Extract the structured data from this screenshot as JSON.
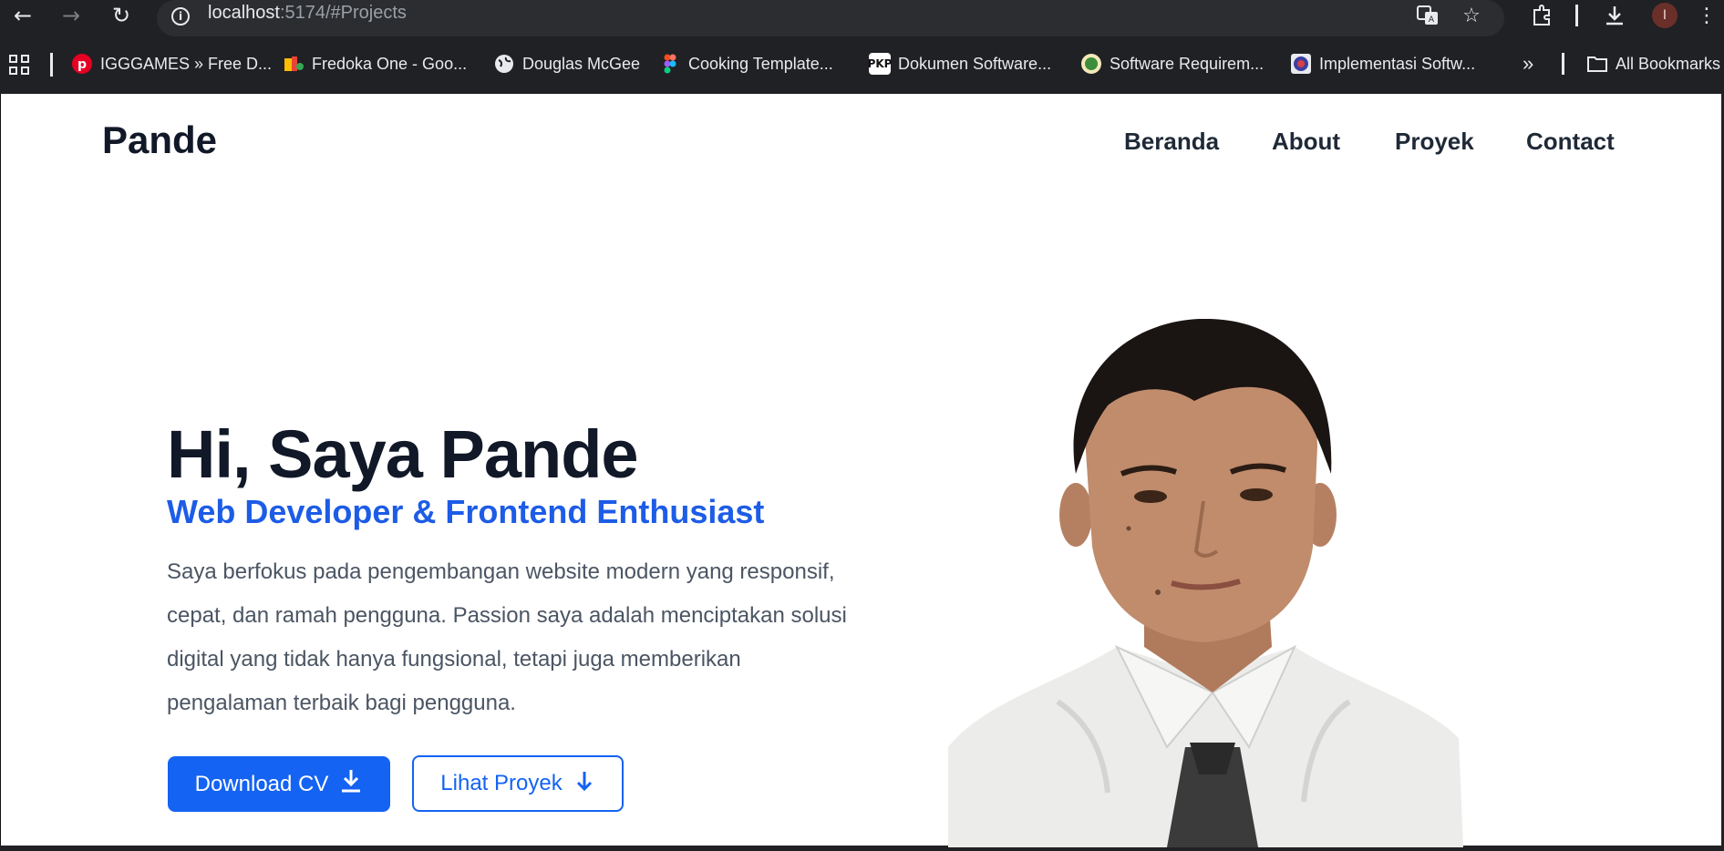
{
  "browser": {
    "url_host": "localhost",
    "url_rest": ":5174/#Projects",
    "profile_initial": "I",
    "bookmarks": [
      "IGGGAMES » Free D...",
      "Fredoka One - Goo...",
      "Douglas McGee",
      "Cooking Template...",
      "Dokumen Software...",
      "Software Requirem...",
      "Implementasi Softw..."
    ],
    "overflow_label": "»",
    "all_bookmarks": "All Bookmarks"
  },
  "site": {
    "logo": "Pande",
    "nav": [
      "Beranda",
      "About",
      "Proyek",
      "Contact"
    ]
  },
  "hero": {
    "title": "Hi, Saya Pande",
    "subtitle": "Web Developer & Frontend Enthusiast",
    "description": "Saya berfokus pada pengembangan website modern yang responsif, cepat, dan ramah pengguna. Passion saya adalah menciptakan solusi digital yang tidak hanya fungsional, tetapi juga memberikan pengalaman terbaik bagi pengguna.",
    "primary_button": "Download CV",
    "secondary_button": "Lihat Proyek"
  },
  "colors": {
    "accent": "#1463f3",
    "heading": "#111827",
    "chrome": "#202124"
  }
}
